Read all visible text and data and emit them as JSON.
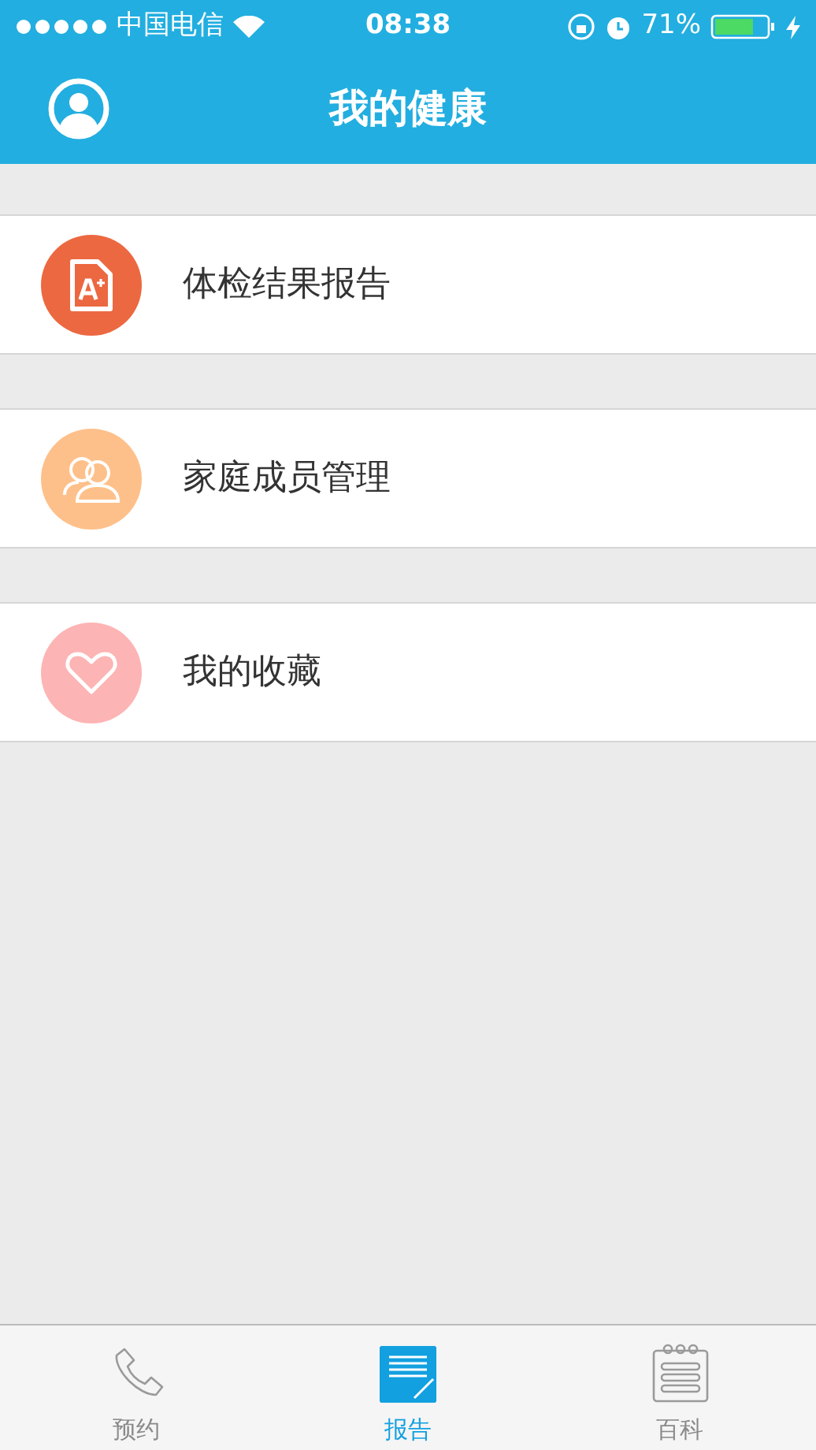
{
  "status_bar": {
    "carrier": "中国电信",
    "time": "08:38",
    "battery": "71%"
  },
  "nav": {
    "title": "我的健康"
  },
  "items": [
    {
      "kind": "report",
      "label": "体检结果报告",
      "color": "#ec6841"
    },
    {
      "kind": "family",
      "label": "家庭成员管理",
      "color": "#fec08a"
    },
    {
      "kind": "favorite",
      "label": "我的收藏",
      "color": "#fdb4b4"
    }
  ],
  "tabs": [
    {
      "kind": "phone",
      "label": "预约",
      "selected": false
    },
    {
      "kind": "report",
      "label": "报告",
      "selected": true
    },
    {
      "kind": "notebook",
      "label": "百科",
      "selected": false
    }
  ]
}
